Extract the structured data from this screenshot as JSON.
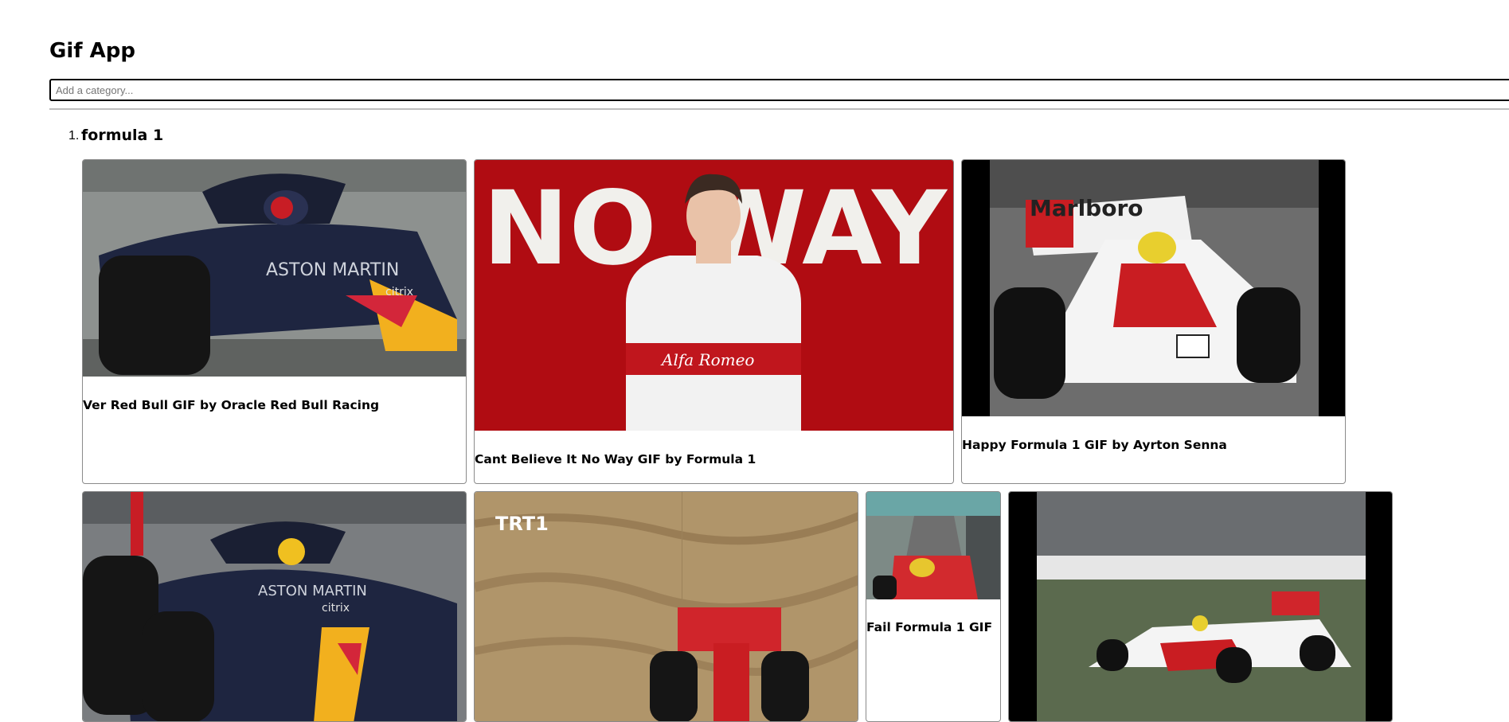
{
  "app": {
    "title": "Gif App"
  },
  "search": {
    "placeholder": "Add a category..."
  },
  "categories": [
    {
      "number": "1.",
      "name": "formula 1",
      "gifs": [
        {
          "title": "Ver Red Bull GIF by Oracle Red Bull Racing"
        },
        {
          "title": "Cant Believe It No Way GIF by Formula 1",
          "overlay_text": "NO WAY"
        },
        {
          "title": "Happy Formula 1 GIF by Ayrton Senna"
        },
        {
          "title": ""
        },
        {
          "title": "",
          "overlay_text": "TRT1"
        },
        {
          "title": "Fail Formula 1 GIF"
        },
        {
          "title": ""
        }
      ]
    }
  ],
  "colors": {
    "border": "#8a8a8a",
    "no_way_red": "#b00c12",
    "redbull_navy": "#1e2540"
  }
}
